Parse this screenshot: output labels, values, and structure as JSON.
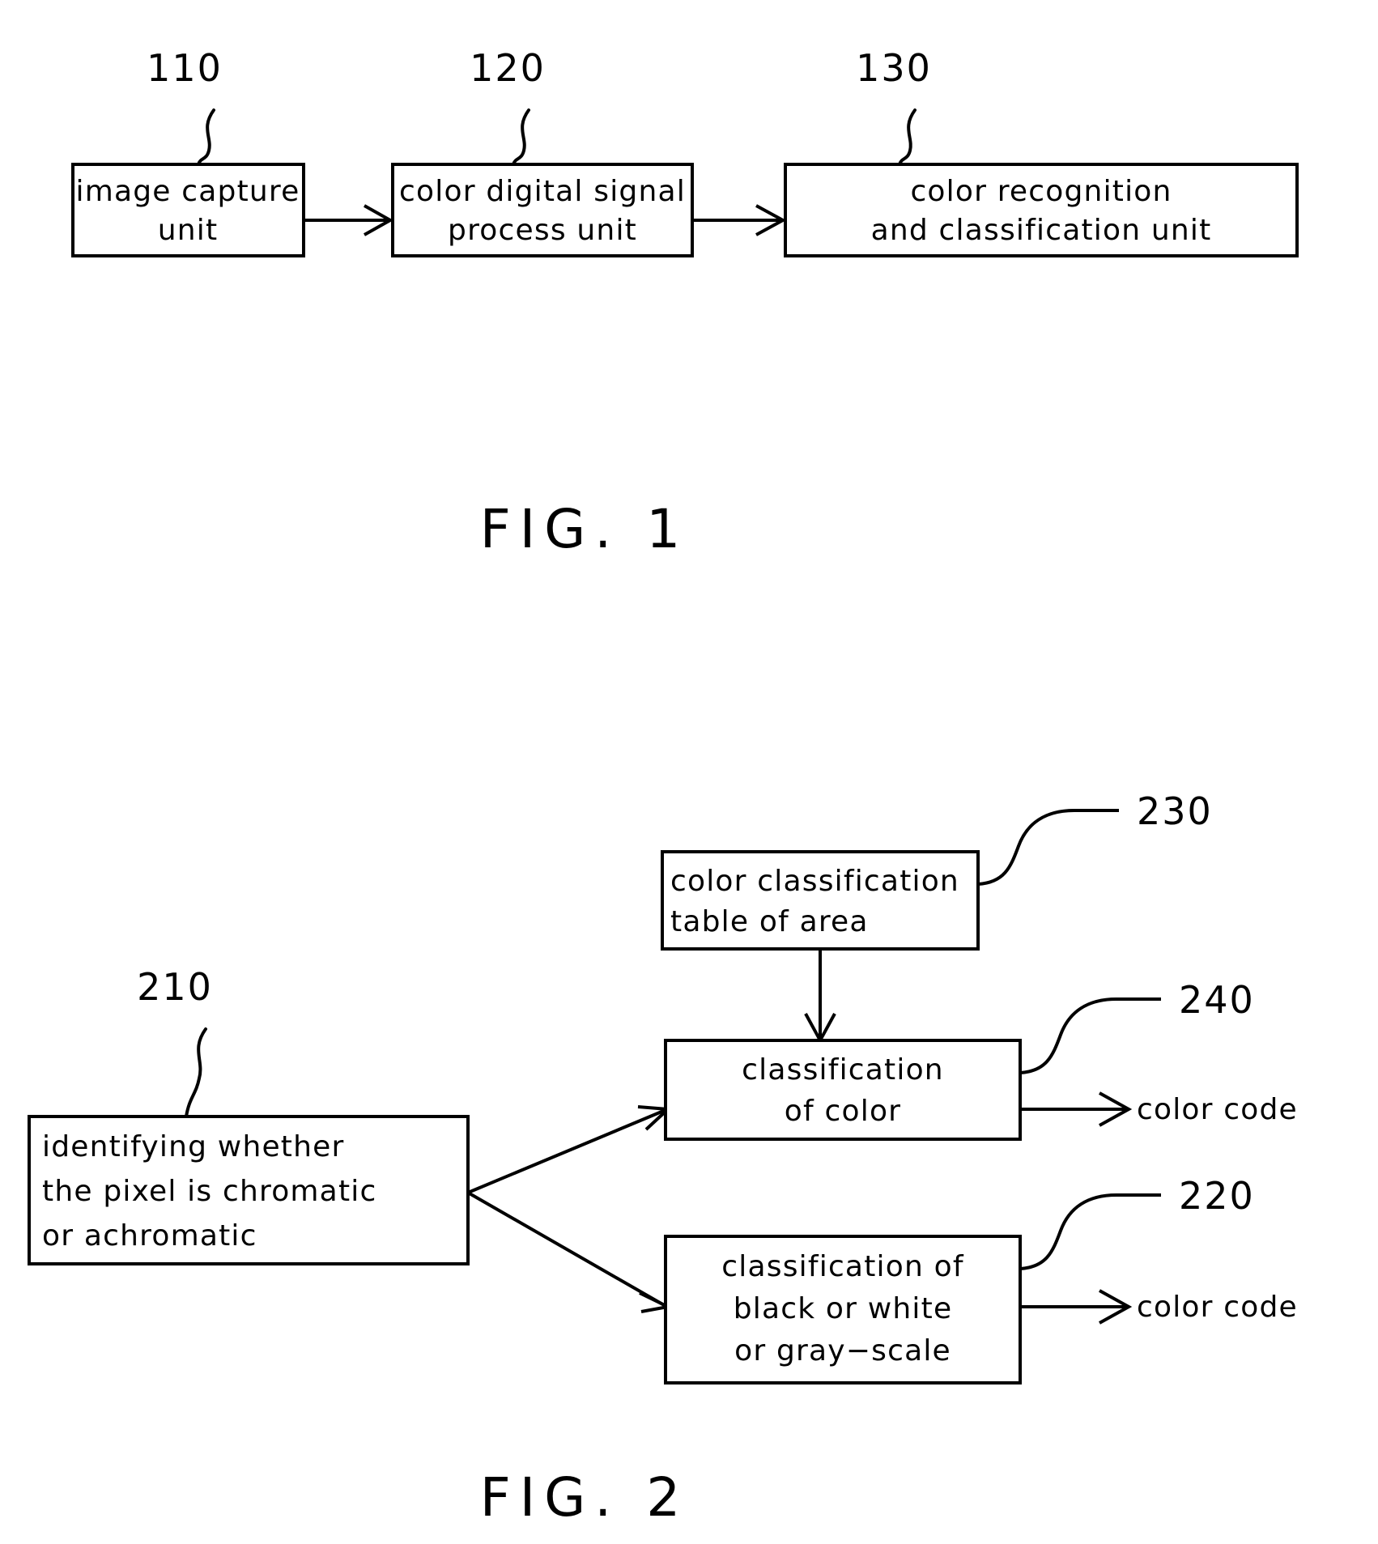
{
  "sheet": {
    "background_color": "#ffffff",
    "ink_color": "#000000"
  },
  "figures": [
    {
      "id": "fig-1",
      "caption": "FIG. 1",
      "boxes": [
        {
          "ref": "110",
          "lines": [
            "image capture",
            "unit"
          ],
          "line1": "image capture",
          "line2": "unit"
        },
        {
          "ref": "120",
          "lines": [
            "color digital signal",
            "process unit"
          ],
          "line1": "color  digital  signal",
          "line2": "process unit"
        },
        {
          "ref": "130",
          "lines": [
            "color recognition",
            "and classification unit"
          ],
          "line1": "color  recognition",
          "line2": "and  classification  unit"
        }
      ]
    },
    {
      "id": "fig-2",
      "caption": "FIG. 2",
      "boxes": [
        {
          "ref": "230",
          "lines": [
            "color classification",
            "table of area"
          ],
          "line1": "color  classification",
          "line2": "table  of  area"
        },
        {
          "ref": "210",
          "lines": [
            "identifying whether",
            "the pixel is chromatic",
            "or achromatic"
          ],
          "line1": "identifying  whether",
          "line2": "the  pixel  is  chromatic",
          "line3": "or  achromatic"
        },
        {
          "ref": "240",
          "lines": [
            "classification",
            "of color"
          ],
          "line1": "classification",
          "line2": "of  color"
        },
        {
          "ref": "220",
          "lines": [
            "classification of",
            "black or white",
            "or gray-scale"
          ],
          "line1": "classification  of",
          "line2": "black  or  white",
          "line3": "or  gray−scale"
        }
      ],
      "outputs": [
        {
          "label": "color  code",
          "from_ref": "240"
        },
        {
          "label": "color  code",
          "from_ref": "220"
        }
      ]
    }
  ]
}
